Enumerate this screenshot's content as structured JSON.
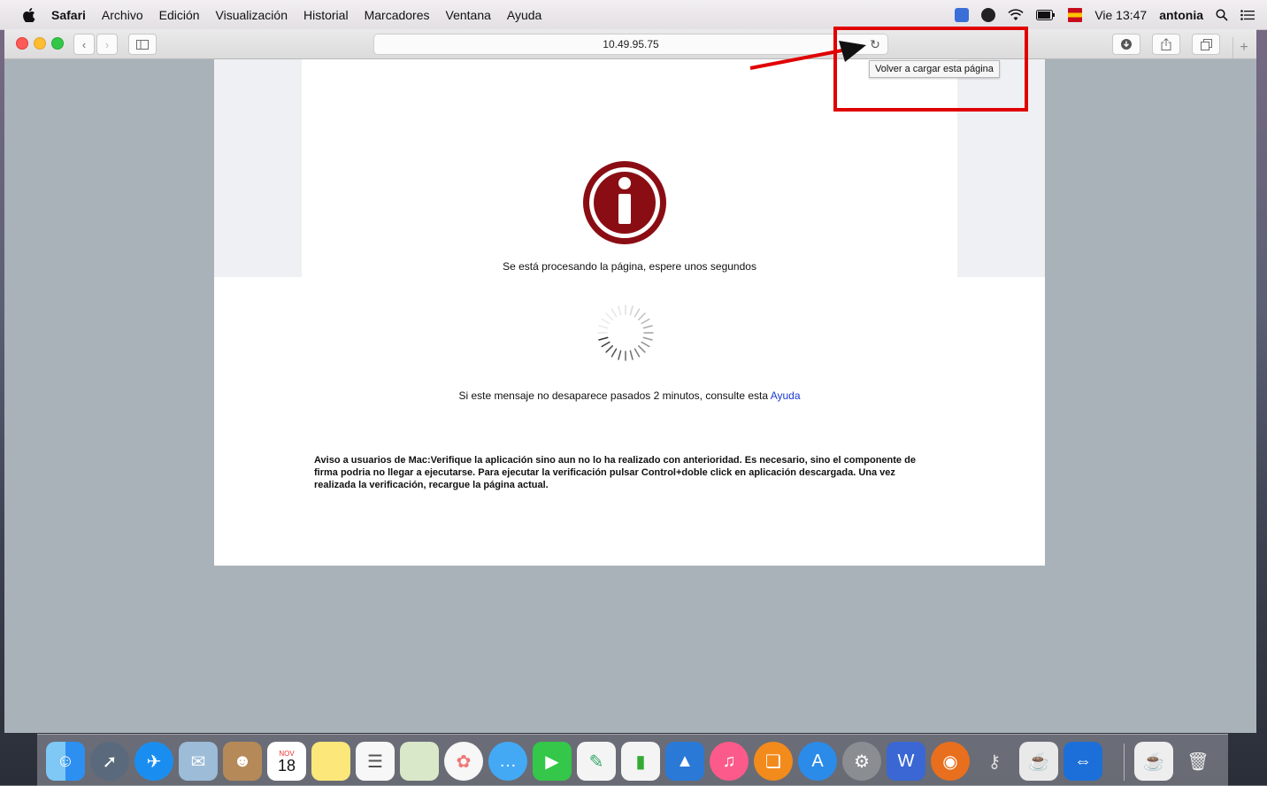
{
  "menubar": {
    "app_name": "Safari",
    "items": [
      "Archivo",
      "Edición",
      "Visualización",
      "Historial",
      "Marcadores",
      "Ventana",
      "Ayuda"
    ],
    "clock": "Vie 13:47",
    "user": "antonia"
  },
  "browser": {
    "url": "10.49.95.75",
    "reload_tooltip": "Volver a cargar esta página"
  },
  "page": {
    "processing_message": "Se está procesando la página, espere unos segundos",
    "help_message": "Si este mensaje no desaparece pasados 2 minutos, consulte esta",
    "help_link": "Ayuda",
    "mac_notice": "Aviso a usuarios de Mac:Verifique la aplicación sino aun no lo ha realizado con anterioridad. Es necesario, sino el componente de firma podria no llegar a ejecutarse. Para ejecutar la verificación pulsar Control+doble click en aplicación descargada. Una vez realizada la verificación, recargue la página actual."
  },
  "dock": {
    "calendar_month": "NOV",
    "calendar_day": "18"
  },
  "colors": {
    "annotation_red": "#e00000",
    "info_icon_red": "#8b0d14",
    "link_blue": "#1a3ad0"
  },
  "icons": [
    "apple-icon",
    "reload-icon",
    "info-icon",
    "loading-spinner-icon",
    "finder-icon",
    "safari-icon",
    "trash-icon"
  ]
}
